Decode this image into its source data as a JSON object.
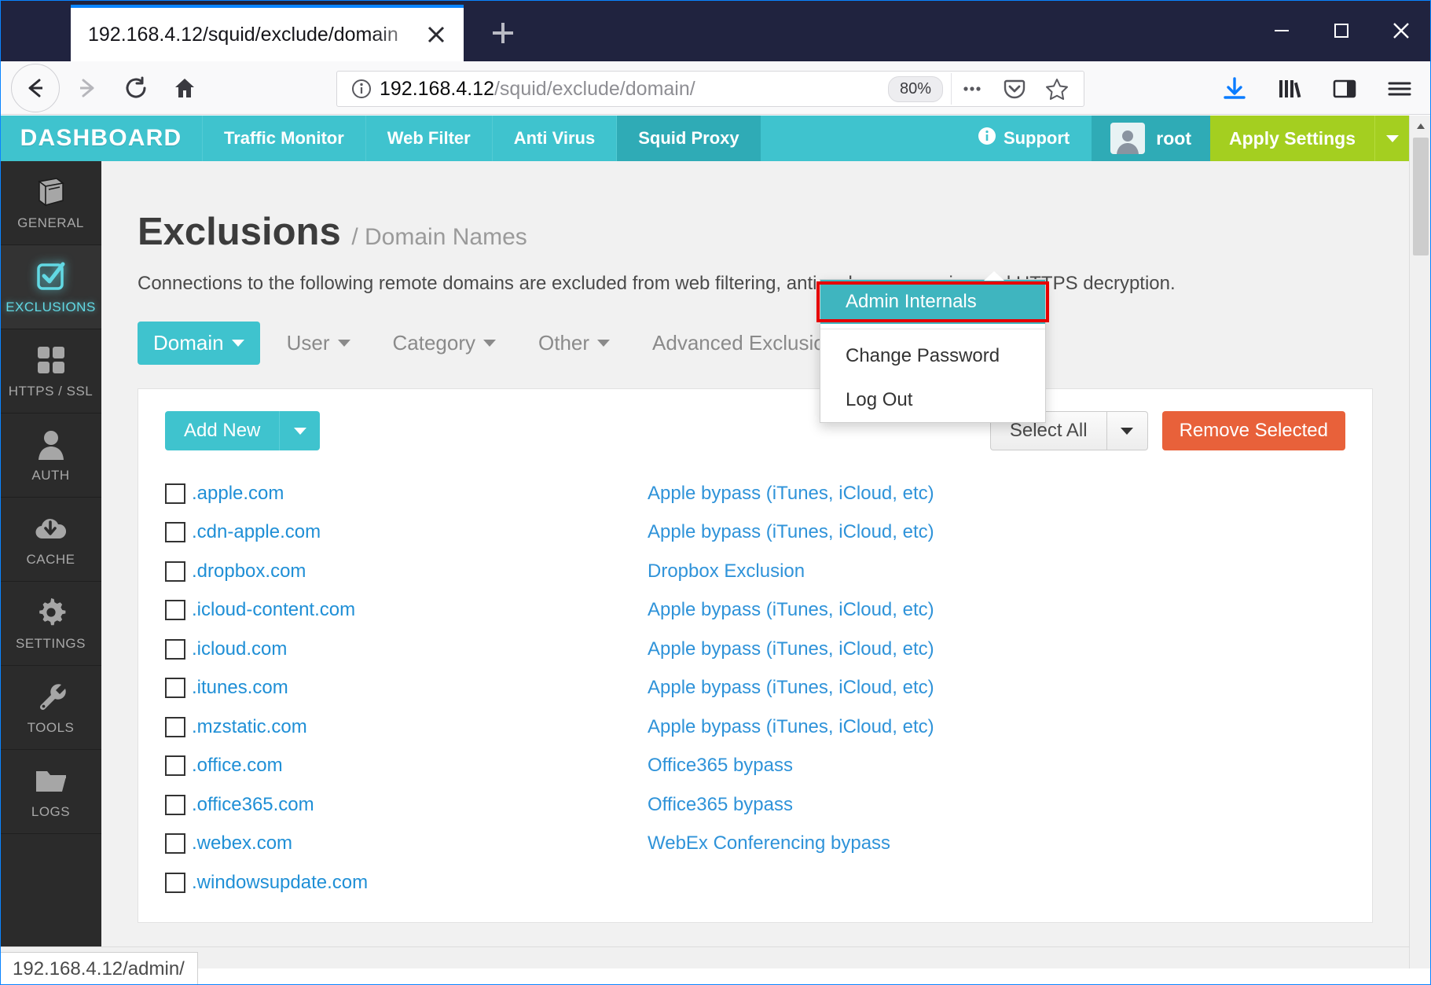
{
  "browser": {
    "tab_title": "192.168.4.12/squid/exclude/domain",
    "tab_close_icon": "close-icon",
    "new_tab_icon": "plus-icon",
    "minimize_icon": "minimize-icon",
    "maximize_icon": "maximize-icon",
    "close_icon": "close-icon",
    "back_icon": "arrow-left-icon",
    "forward_icon": "arrow-right-icon",
    "reload_icon": "reload-icon",
    "home_icon": "home-icon",
    "url_info_icon": "info-icon",
    "url_host": "192.168.4.12",
    "url_path": "/squid/exclude/domain/",
    "zoom_level": "80%",
    "page_actions_icon": "ellipsis-icon",
    "pocket_icon": "pocket-icon",
    "bookmark_icon": "star-icon",
    "download_icon": "download-icon",
    "library_icon": "library-icon",
    "sidebar_icon": "sidebar-icon",
    "menu_icon": "hamburger-menu-icon",
    "status_text": "192.168.4.12/admin/"
  },
  "appnav": {
    "brand": "DASHBOARD",
    "items": [
      {
        "label": "Traffic Monitor",
        "active": false
      },
      {
        "label": "Web Filter",
        "active": false
      },
      {
        "label": "Anti Virus",
        "active": false
      },
      {
        "label": "Squid Proxy",
        "active": true
      }
    ],
    "support_label": "Support",
    "support_icon": "info-circle-icon",
    "user_label": "root",
    "user_avatar_icon": "user-avatar-icon",
    "apply_label": "Apply Settings",
    "apply_caret_icon": "chevron-down-icon"
  },
  "user_menu": {
    "items": [
      {
        "label": "Admin Internals",
        "active": true
      },
      {
        "label": "Change Password",
        "active": false
      },
      {
        "label": "Log Out",
        "active": false
      }
    ]
  },
  "sidebar": {
    "items": [
      {
        "label": "GENERAL",
        "icon": "book-icon",
        "active": false
      },
      {
        "label": "EXCLUSIONS",
        "icon": "checkbox-check-icon",
        "active": true
      },
      {
        "label": "HTTPS / SSL",
        "icon": "grid-squares-icon",
        "active": false
      },
      {
        "label": "AUTH",
        "icon": "user-icon",
        "active": false
      },
      {
        "label": "CACHE",
        "icon": "cloud-download-icon",
        "active": false
      },
      {
        "label": "SETTINGS",
        "icon": "gear-icon",
        "active": false
      },
      {
        "label": "TOOLS",
        "icon": "wrench-icon",
        "active": false
      },
      {
        "label": "LOGS",
        "icon": "folder-icon",
        "active": false
      }
    ]
  },
  "page": {
    "title": "Exclusions",
    "subtitle": "/ Domain Names",
    "description": "Connections to the following remote domains are excluded from web filtering, anti malware scanning and HTTPS decryption.",
    "tabs": [
      {
        "label": "Domain",
        "active": true
      },
      {
        "label": "User",
        "active": false
      },
      {
        "label": "Category",
        "active": false
      },
      {
        "label": "Other",
        "active": false
      },
      {
        "label": "Advanced Exclusions",
        "active": false
      }
    ],
    "toolbar": {
      "add_new_label": "Add New",
      "add_new_caret_icon": "chevron-down-icon",
      "select_all_label": "Select All",
      "select_all_caret_icon": "chevron-down-icon",
      "remove_selected_label": "Remove Selected"
    },
    "rows": [
      {
        "domain": ".apple.com",
        "description": "Apple bypass (iTunes, iCloud, etc)",
        "checked": false
      },
      {
        "domain": ".cdn-apple.com",
        "description": "Apple bypass (iTunes, iCloud, etc)",
        "checked": false
      },
      {
        "domain": ".dropbox.com",
        "description": "Dropbox Exclusion",
        "checked": false
      },
      {
        "domain": ".icloud-content.com",
        "description": "Apple bypass (iTunes, iCloud, etc)",
        "checked": false
      },
      {
        "domain": ".icloud.com",
        "description": "Apple bypass (iTunes, iCloud, etc)",
        "checked": false
      },
      {
        "domain": ".itunes.com",
        "description": "Apple bypass (iTunes, iCloud, etc)",
        "checked": false
      },
      {
        "domain": ".mzstatic.com",
        "description": "Apple bypass (iTunes, iCloud, etc)",
        "checked": false
      },
      {
        "domain": ".office.com",
        "description": "Office365 bypass",
        "checked": false
      },
      {
        "domain": ".office365.com",
        "description": "Office365 bypass",
        "checked": false
      },
      {
        "domain": ".webex.com",
        "description": "WebEx Conferencing bypass",
        "checked": false
      },
      {
        "domain": ".windowsupdate.com",
        "description": "",
        "checked": false
      }
    ]
  },
  "colors": {
    "brand_teal": "#3fc3ce",
    "brand_teal_dark": "#2fabb6",
    "apply_green": "#a4cf20",
    "remove_red": "#e8613a",
    "link_blue": "#2f93d9",
    "highlight_red": "#e60000",
    "sidebar_dark": "#2b2b2b",
    "chrome_dark": "#20233f"
  }
}
